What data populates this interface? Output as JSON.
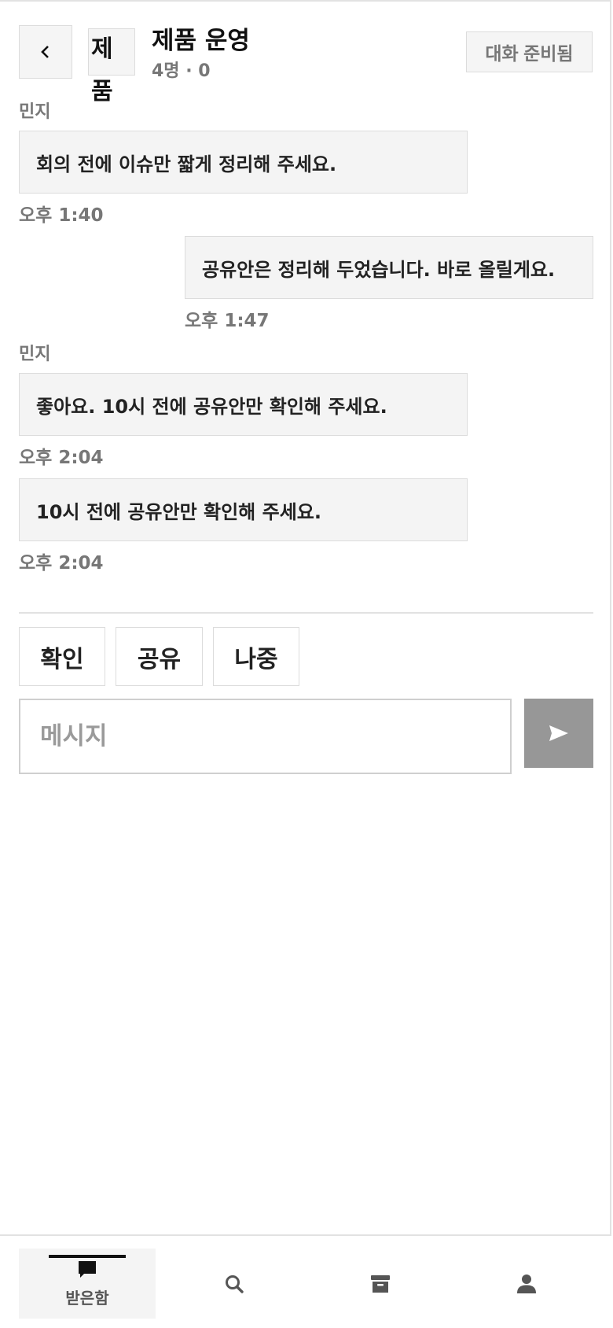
{
  "header": {
    "back_icon": "chevron-left-icon",
    "avatar_text": "제품",
    "title": "제품 운영",
    "meta": "4명 · 0",
    "status_label": "대화 준비됨"
  },
  "messages": [
    {
      "sender": "민지",
      "text": "회의 전에 이슈만 짧게 정리해 주세요.",
      "time": "오후 1:40",
      "direction": "incoming"
    },
    {
      "sender": "",
      "text": "공유안은 정리해 두었습니다. 바로 올릴게요.",
      "time": "오후 1:47",
      "direction": "outgoing"
    },
    {
      "sender": "민지",
      "text": "좋아요. 10시 전에 공유안만 확인해 주세요.",
      "time": "오후 2:04",
      "direction": "incoming"
    },
    {
      "sender": "",
      "text": "10시 전에 공유안만 확인해 주세요.",
      "time": "오후 2:04",
      "direction": "incoming"
    }
  ],
  "quick_replies": [
    "확인",
    "공유",
    "나중"
  ],
  "composer": {
    "placeholder": "메시지",
    "value": "",
    "send_icon": "send-icon"
  },
  "nav": {
    "items": [
      {
        "label": "받은함",
        "icon": "chat-bubble-icon",
        "active": true
      },
      {
        "label": "",
        "icon": "search-icon",
        "active": false
      },
      {
        "label": "",
        "icon": "archive-icon",
        "active": false
      },
      {
        "label": "",
        "icon": "person-icon",
        "active": false
      }
    ]
  },
  "colors": {
    "bubble_bg": "#f4f4f4",
    "border": "#dcdcdc",
    "muted_text": "#777777",
    "send_button": "#979797",
    "nav_icon": "#555555"
  }
}
